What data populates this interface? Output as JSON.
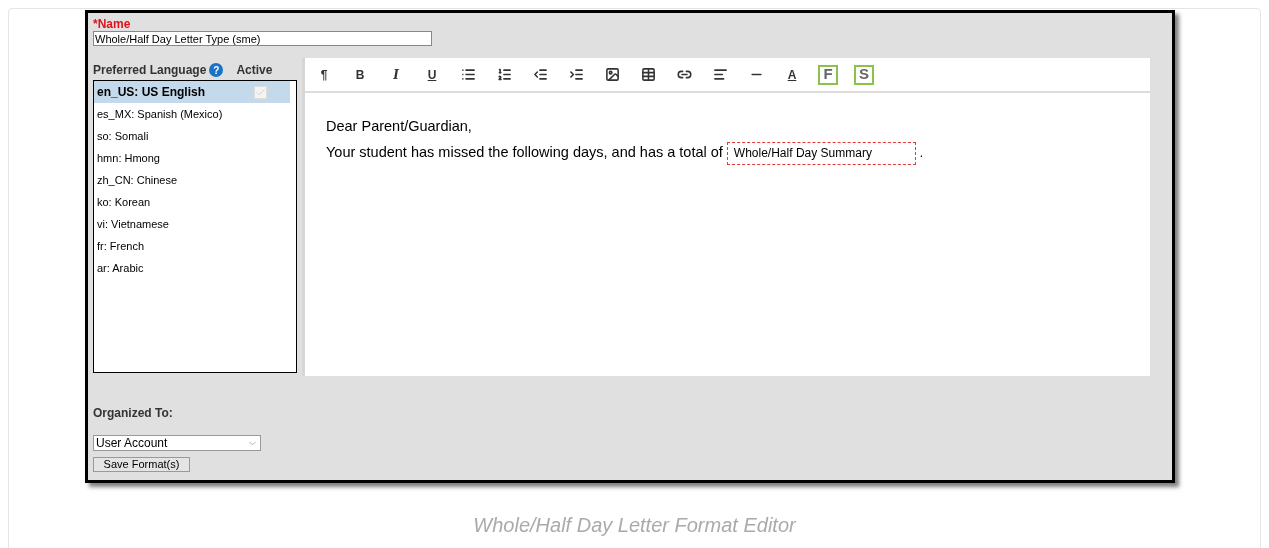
{
  "name_field": {
    "label": "*Name",
    "value": "Whole/Half Day Letter Type (sme)"
  },
  "languages": {
    "heading": "Preferred Language",
    "help": "?",
    "active_heading": "Active",
    "items": [
      {
        "label": "en_US: US English",
        "selected": true,
        "active": true
      },
      {
        "label": "es_MX: Spanish (Mexico)",
        "selected": false
      },
      {
        "label": "so: Somali",
        "selected": false
      },
      {
        "label": "hmn: Hmong",
        "selected": false
      },
      {
        "label": "zh_CN: Chinese",
        "selected": false
      },
      {
        "label": "ko: Korean",
        "selected": false
      },
      {
        "label": "vi: Vietnamese",
        "selected": false
      },
      {
        "label": "fr: French",
        "selected": false
      },
      {
        "label": "ar: Arabic",
        "selected": false
      }
    ]
  },
  "toolbar": [
    {
      "kind": "glyph",
      "label": "¶"
    },
    {
      "kind": "glyph",
      "label": "B"
    },
    {
      "kind": "glyph",
      "label": "I"
    },
    {
      "kind": "glyph",
      "label": "U"
    },
    {
      "kind": "icon"
    },
    {
      "kind": "icon"
    },
    {
      "kind": "icon"
    },
    {
      "kind": "icon"
    },
    {
      "kind": "icon"
    },
    {
      "kind": "icon"
    },
    {
      "kind": "icon"
    },
    {
      "kind": "icon"
    },
    {
      "kind": "icon"
    },
    {
      "kind": "glyph",
      "label": "A"
    },
    {
      "kind": "boxed",
      "label": "F"
    },
    {
      "kind": "boxed",
      "label": "S"
    }
  ],
  "editor": {
    "greeting": "Dear Parent/Guardian,",
    "sentence": "Your student has missed the following days, and has a total of",
    "field": "Whole/Half Day Summary",
    "end": "."
  },
  "organized_to": {
    "label": "Organized To:",
    "value": "User Account"
  },
  "save_button": "Save Format(s)",
  "caption": "Whole/Half Day Letter Format Editor"
}
